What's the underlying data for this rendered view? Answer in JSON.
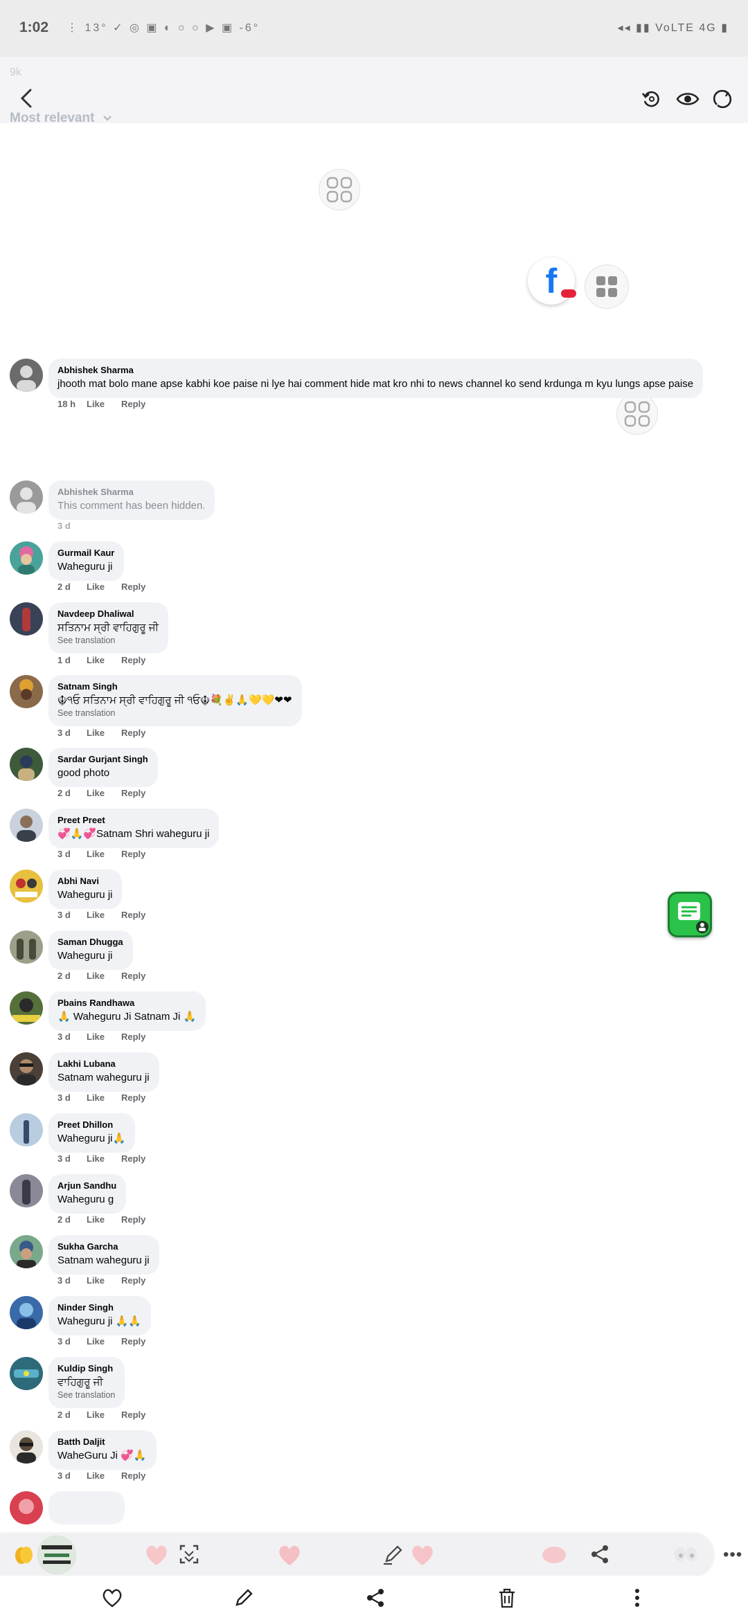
{
  "status_bar": {
    "time": "1:02",
    "left_icons": "⋮ 13° ✓ ◎ ▣ ◐ ○ ○ ▶ ▣ -6°",
    "temperature": "13°",
    "right_icons": "◂◂ ▮▮ VoLTE 4G ▮"
  },
  "header": {
    "ghost_count": "9k"
  },
  "sort": {
    "label": "Most relevant"
  },
  "comments": [
    {
      "name": "Abhishek Sharma",
      "text": "jhooth mat bolo mane apse kabhi koe paise ni lye hai comment hide mat kro nhi to news channel ko send krdunga m kyu lungs apse paise",
      "time": "18 h",
      "like": "Like",
      "reply": "Reply",
      "avatar_color": "#6b6b6b"
    },
    {
      "name": "Abhishek Sharma",
      "text": "This comment has been hidden.",
      "time": "3 d",
      "avatar_color": "#9a9a9a"
    },
    {
      "name": "Gurmail Kaur",
      "text": "Waheguru ji",
      "time": "2 d",
      "like": "Like",
      "reply": "Reply",
      "avatar_color": "#4aa39a"
    },
    {
      "name": "Navdeep Dhaliwal",
      "text": "ਸਤਿਨਾਮ ਸ੍ਰੀ ਵਾਹਿਗੁਰੂ ਜੀ",
      "translation": "See translation",
      "time": "1 d",
      "like": "Like",
      "reply": "Reply",
      "avatar_color": "#3a4258"
    },
    {
      "name": "Satnam Singh",
      "text": "☬੧ਓ ਸਤਿਨਾਮ ਸ੍ਰੀ ਵਾਹਿਗੁਰੂ ਜੀ ੧ਓ☬💐✌🙏💛💛❤❤",
      "translation": "See translation",
      "time": "3 d",
      "like": "Like",
      "reply": "Reply",
      "avatar_color": "#8a6a4a"
    },
    {
      "name": "Sardar Gurjant Singh",
      "text": "good photo",
      "time": "2 d",
      "like": "Like",
      "reply": "Reply",
      "avatar_color": "#3d5a3a"
    },
    {
      "name": "Preet Preet",
      "text": "💞🙏💞Satnam Shri waheguru ji",
      "time": "3 d",
      "like": "Like",
      "reply": "Reply",
      "avatar_color": "#7c8794"
    },
    {
      "name": "Abhi Navi",
      "text": "Waheguru ji",
      "time": "3 d",
      "like": "Like",
      "reply": "Reply",
      "avatar_color": "#c7a24a"
    },
    {
      "name": "Saman Dhugga",
      "text": "Waheguru ji",
      "time": "2 d",
      "like": "Like",
      "reply": "Reply",
      "avatar_color": "#6d7a5a"
    },
    {
      "name": "Pbains Randhawa",
      "text": "🙏 Waheguru Ji Satnam Ji 🙏",
      "time": "3 d",
      "like": "Like",
      "reply": "Reply",
      "avatar_color": "#55703a"
    },
    {
      "name": "Lakhi Lubana",
      "text": "Satnam waheguru ji",
      "time": "3 d",
      "like": "Like",
      "reply": "Reply",
      "avatar_color": "#4a4038"
    },
    {
      "name": "Preet Dhillon",
      "text": "Waheguru ji🙏",
      "time": "3 d",
      "like": "Like",
      "reply": "Reply",
      "avatar_color": "#8aa8c0"
    },
    {
      "name": "Arjun Sandhu",
      "text": "Waheguru g",
      "time": "2 d",
      "like": "Like",
      "reply": "Reply",
      "avatar_color": "#6a6a78"
    },
    {
      "name": "Sukha Garcha",
      "text": "Satnam waheguru ji",
      "time": "3 d",
      "like": "Like",
      "reply": "Reply",
      "avatar_color": "#4e7a5e"
    },
    {
      "name": "Ninder Singh",
      "text": "Waheguru ji 🙏🙏",
      "time": "3 d",
      "like": "Like",
      "reply": "Reply",
      "avatar_color": "#3a6aa8"
    },
    {
      "name": "Kuldip Singh",
      "text": "ਵਾਹਿਗੁਰੂ ਜੀ",
      "translation": "See translation",
      "time": "2 d",
      "like": "Like",
      "reply": "Reply",
      "avatar_color": "#2e6a7a"
    },
    {
      "name": "Batth Daljit",
      "text": "WaheGuru Ji 💞🙏",
      "time": "3 d",
      "like": "Like",
      "reply": "Reply",
      "avatar_color": "#5a4a3a"
    },
    {
      "name": "",
      "text": "",
      "avatar_color": "#d94050"
    }
  ],
  "colors": {
    "bubble": "#f0f2f5",
    "meta": "#65676b",
    "facebook_blue": "#1877f2",
    "chat_green": "#2bc24a"
  },
  "toolbar": {
    "overlay_icons": [
      "clap-icon",
      "heart-icon",
      "scan-icon",
      "heart-icon",
      "edit-icon",
      "heart-icon",
      "brain-icon",
      "share-icon",
      "eyes-icon"
    ],
    "more": "•••",
    "bottom_icons": [
      "heart-icon",
      "pencil-icon",
      "share-icon",
      "trash-icon",
      "more-vertical-icon"
    ]
  }
}
